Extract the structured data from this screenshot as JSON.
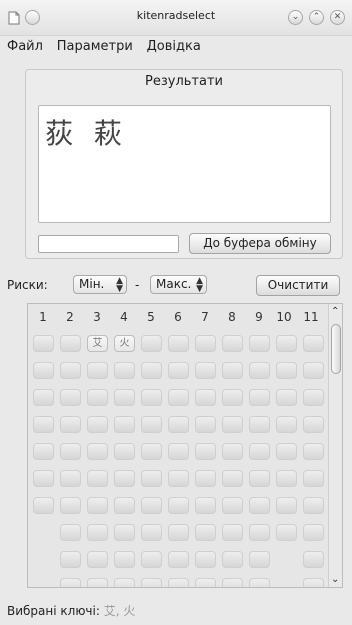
{
  "window": {
    "title": "kitenradselect"
  },
  "menu": {
    "items": [
      "Файл",
      "Параметри",
      "Довідка"
    ]
  },
  "results": {
    "group_title": "Результати",
    "kanji": "荻 萩",
    "copy_input": "",
    "copy_button": "До буфера обміну"
  },
  "strokes": {
    "label": "Риски:",
    "min": "Мін.",
    "dash": "-",
    "max": "Макс.",
    "clear_button": "Очистити"
  },
  "grid": {
    "columns": [
      "1",
      "2",
      "3",
      "4",
      "5",
      "6",
      "7",
      "8",
      "9",
      "10",
      "11"
    ],
    "selected": [
      "艾",
      "火"
    ]
  },
  "status": {
    "label": "Вибрані ключі:",
    "keys": "艾, 火"
  }
}
